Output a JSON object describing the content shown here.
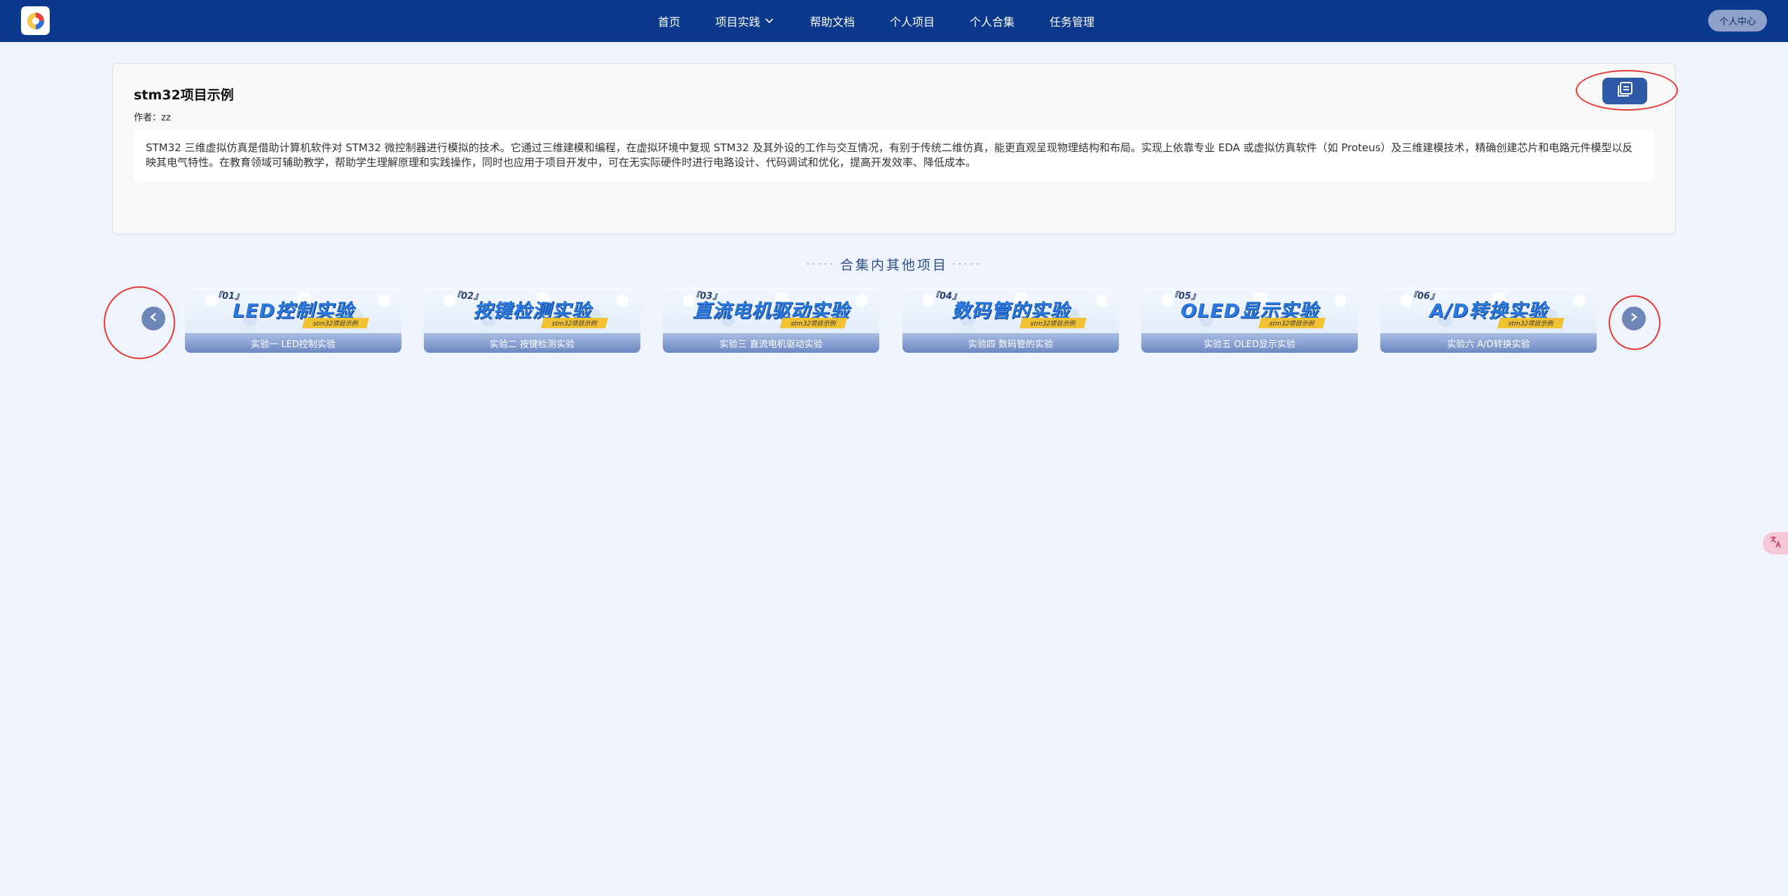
{
  "header": {
    "nav": [
      {
        "label": "首页"
      },
      {
        "label": "项目实践"
      },
      {
        "label": "帮助文档"
      },
      {
        "label": "个人项目"
      },
      {
        "label": "个人合集"
      },
      {
        "label": "任务管理"
      }
    ],
    "user_center_label": "个人中心"
  },
  "project": {
    "title": "stm32项目示例",
    "author": "作者：zz",
    "description": "STM32 三维虚拟仿真是借助计算机软件对 STM32 微控制器进行模拟的技术。它通过三维建模和编程，在虚拟环境中复现 STM32 及其外设的工作与交互情况，有别于传统二维仿真，能更直观呈现物理结构和布局。实现上依靠专业 EDA 或虚拟仿真软件（如 Proteus）及三维建模技术，精确创建芯片和电路元件模型以反映其电气特性。在教育领域可辅助教学，帮助学生理解原理和实践操作，同时也应用于项目开发中，可在无实际硬件时进行电路设计、代码调试和优化，提高开发效率、降低成本。"
  },
  "collection": {
    "title": "合集内其他项目",
    "items": [
      {
        "num": "『01』",
        "banner": "LED控制实验",
        "tag": "stm32项目示例",
        "label": "实验一 LED控制实验"
      },
      {
        "num": "『02』",
        "banner": "按键检测实验",
        "tag": "stm32项目示例",
        "label": "实验二 按键检测实验"
      },
      {
        "num": "『03』",
        "banner": "直流电机驱动实验",
        "tag": "stm32项目示例",
        "label": "实验三 直流电机驱动实验"
      },
      {
        "num": "『04』",
        "banner": "数码管的实验",
        "tag": "stm32项目示例",
        "label": "实验四 数码管的实验"
      },
      {
        "num": "『05』",
        "banner": "OLED显示实验",
        "tag": "stm32项目示例",
        "label": "实验五 OLED显示实验"
      },
      {
        "num": "『06』",
        "banner": "A/D转换实验",
        "tag": "stm32项目示例",
        "label": "实验六 A/D转换实验"
      }
    ]
  },
  "icons": {
    "logo": "app-logo-icon",
    "copy": "copy-icon",
    "prev": "chevron-left-icon",
    "next": "chevron-right-icon",
    "nav_dropdown": "chevron-down-icon",
    "translate": "translate-icon"
  },
  "colors": {
    "header_bg": "#0b3a8c",
    "page_bg": "#eef3fc",
    "accent": "#2d5aa6",
    "highlight_ellipse": "#e53935"
  }
}
